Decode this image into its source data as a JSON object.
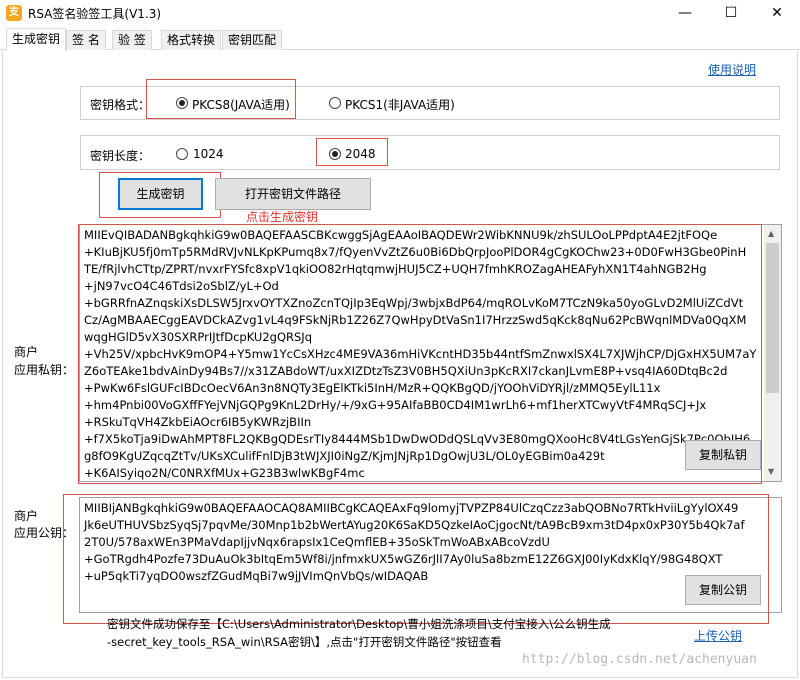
{
  "window": {
    "title": "RSA签名验签工具(V1.3)",
    "icon_glyph": "支",
    "minimize": "—",
    "maximize": "☐",
    "close": "✕"
  },
  "tabs": [
    {
      "label": "生成密钥",
      "active": true
    },
    {
      "label": "签 名",
      "active": false
    },
    {
      "label": "验 签",
      "active": false
    },
    {
      "label": "格式转换",
      "active": false
    },
    {
      "label": "密钥匹配",
      "active": false
    }
  ],
  "help_link": "使用说明",
  "key_format": {
    "label": "密钥格式：",
    "options": [
      "PKCS8(JAVA适用)",
      "PKCS1(非JAVA适用)"
    ],
    "selected": "PKCS8(JAVA适用)"
  },
  "key_length": {
    "label": "密钥长度：",
    "options": [
      "1024",
      "2048"
    ],
    "selected": "2048"
  },
  "buttons": {
    "generate": "生成密钥",
    "open_path": "打开密钥文件路径",
    "copy_private": "复制私钥",
    "copy_public": "复制公钥"
  },
  "hint": "点击生成密钥",
  "private_key": {
    "label_line1": "商户",
    "label_line2": "应用私钥：",
    "lines": [
      "MIIEvQIBADANBgkqhkiG9w0BAQEFAASCBKcwggSjAgEAAoIBAQDEWr2WibKNNU9k/zhSULOoLPPdptA4E2jtFOQe",
      "+KIuBjKU5fj0mTp5RMdRVJvNLKpKPumq8x7/fQyenVvZtZ6u0Bi6DbQrpJooPlDOR4gCgKOChw23+0D0FwH3Gbe0PinH",
      "TE/fRjlvhCTtp/ZPRT/nvxrFYSfc8xpV1qkiOO82rHqtqmwjHUJ5CZ+UQH7fmhKROZagAHEAFyhXN1T4ahNGB2Hg",
      "+jN97vcO4C46Tdsi2oSblZ/yL+Od",
      "+bGRRfnAZnqskiXsDLSW5JrxvOYTXZnoZcnTQjIp3EqWpj/3wbjxBdP64/mqROLvKoM7TCzN9ka50yoGLvD2MlUiZCdVt",
      "Cz/AgMBAAECggEAVDCkAZvg1vL4q9FSkNjRb1Z26Z7QwHpyDtVaSn1I7HrzzSwd5qKck8qNu62PcBWqnlMDVa0QqXM",
      "wqgHGlD5vX30SXRPrIJtfDcpKU2gQRSJq",
      "+Vh25V/xpbcHvK9mOP4+Y5mw1YcCsXHzc4ME9VA36mHiVKcntHD35b44ntfSmZnwxlSX4L7XJWjhCP/DjGxHX5UM7aY",
      "Z6oTEAke1bdvAinDy94Bs7//x31ZABdoWT/uxXIZDtzTsZ3V0BH5QXiUn3pKcRXI7ckanJLvmE8P+vsq4IA60DtqBc2d",
      "+PwKw6FslGUFcIBDcOecV6An3n8NQTy3EgElKTki5InH/MzR+QQKBgQD/jYOOhViDYRjl/zMMQ5EylL11x",
      "+hm4Pnbi00VoGXffFYejVNjGQPg9KnL2DrHy/+/9xG+95AIfaBB0CD4IM1wrLh6+mf1herXTCwyVtF4MRqSCJ+Jx",
      "+RSkuTqVH4ZkbEiAOcr6IB5yKWRzjBIIn",
      "+f7X5koTja9iDwAhMPT8FL2QKBgQDEsrTIy8444MSb1DwDwODdQSLqVv3E80mgQXooHc8V4tLGsYenGjSk7Pc0ObIH6",
      "g8fO9KgUZqcqZtTv/UKsXCulifFnlDjB3tWJXJI0iNgZ/KjmJNjRp1DgOwjU3L/OL0yEGBim0a429t",
      "+K6AISyiqo2N/C0NRXfMUx+G23B3wlwKBgF4mc"
    ]
  },
  "public_key": {
    "label_line1": "商户",
    "label_line2": "应用公钥：",
    "lines": [
      "MIIBIjANBgkqhkiG9w0BAQEFAAOCAQ8AMIIBCgKCAQEAxFq9lomyjTVPZP84UlCzqCzz3abQOBNo7RTkHviiLgYylOX49",
      "Jk6eUTHUVSbzSyqSj7pqvMe/30Mnp1b2bWertAYug20K6SaKD5QzkeIAoCjgocNt/tA9BcB9xm3tD4px0xP30Y5b4Qk7af",
      "2T0U/578axWEn3PMaVdapIjjvNqx6rapsIx1CeQmflEB+35oSkTmWoABxABcoVzdU",
      "+GoTRgdh4Pozfe73DuAuOk3bItqEm5Wf8i/jnfmxkUX5wGZ6rJlI7Ay0luSa8bzmE12Z6GXJ00IyKdxKlqY/98G48QXT",
      "+uP5qkTi7yqDO0wszfZGudMqBi7w9jJVImQnVbQs/wIDAQAB"
    ]
  },
  "footer": {
    "line1": "密钥文件成功保存至【C:\\Users\\Administrator\\Desktop\\曹小姐洗涤项目\\支付宝接入\\公么钥生成",
    "line2": "-secret_key_tools_RSA_win\\RSA密钥\\】,点击\"打开密钥文件路径\"按钮查看",
    "upload_link": "上传公钥"
  },
  "watermark": "http://blog.csdn.net/achenyuan"
}
